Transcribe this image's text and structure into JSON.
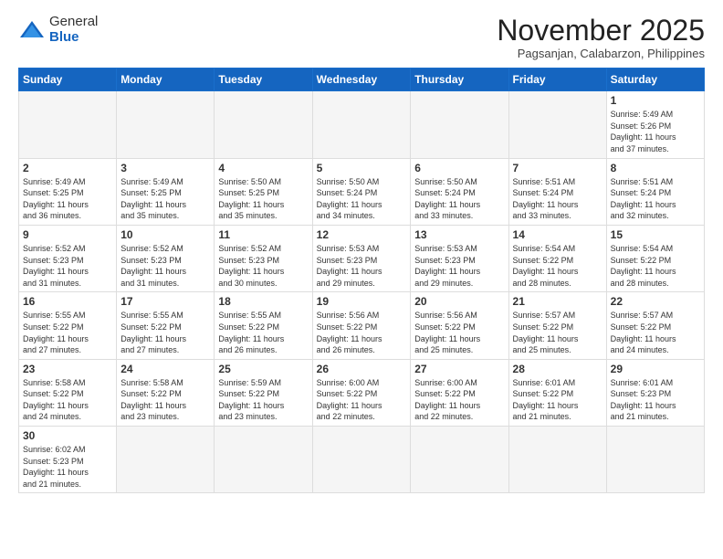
{
  "logo": {
    "general": "General",
    "blue": "Blue"
  },
  "title": "November 2025",
  "subtitle": "Pagsanjan, Calabarzon, Philippines",
  "days_of_week": [
    "Sunday",
    "Monday",
    "Tuesday",
    "Wednesday",
    "Thursday",
    "Friday",
    "Saturday"
  ],
  "weeks": [
    [
      {
        "day": "",
        "info": ""
      },
      {
        "day": "",
        "info": ""
      },
      {
        "day": "",
        "info": ""
      },
      {
        "day": "",
        "info": ""
      },
      {
        "day": "",
        "info": ""
      },
      {
        "day": "",
        "info": ""
      },
      {
        "day": "1",
        "info": "Sunrise: 5:49 AM\nSunset: 5:26 PM\nDaylight: 11 hours\nand 37 minutes."
      }
    ],
    [
      {
        "day": "2",
        "info": "Sunrise: 5:49 AM\nSunset: 5:25 PM\nDaylight: 11 hours\nand 36 minutes."
      },
      {
        "day": "3",
        "info": "Sunrise: 5:49 AM\nSunset: 5:25 PM\nDaylight: 11 hours\nand 35 minutes."
      },
      {
        "day": "4",
        "info": "Sunrise: 5:50 AM\nSunset: 5:25 PM\nDaylight: 11 hours\nand 35 minutes."
      },
      {
        "day": "5",
        "info": "Sunrise: 5:50 AM\nSunset: 5:24 PM\nDaylight: 11 hours\nand 34 minutes."
      },
      {
        "day": "6",
        "info": "Sunrise: 5:50 AM\nSunset: 5:24 PM\nDaylight: 11 hours\nand 33 minutes."
      },
      {
        "day": "7",
        "info": "Sunrise: 5:51 AM\nSunset: 5:24 PM\nDaylight: 11 hours\nand 33 minutes."
      },
      {
        "day": "8",
        "info": "Sunrise: 5:51 AM\nSunset: 5:24 PM\nDaylight: 11 hours\nand 32 minutes."
      }
    ],
    [
      {
        "day": "9",
        "info": "Sunrise: 5:52 AM\nSunset: 5:23 PM\nDaylight: 11 hours\nand 31 minutes."
      },
      {
        "day": "10",
        "info": "Sunrise: 5:52 AM\nSunset: 5:23 PM\nDaylight: 11 hours\nand 31 minutes."
      },
      {
        "day": "11",
        "info": "Sunrise: 5:52 AM\nSunset: 5:23 PM\nDaylight: 11 hours\nand 30 minutes."
      },
      {
        "day": "12",
        "info": "Sunrise: 5:53 AM\nSunset: 5:23 PM\nDaylight: 11 hours\nand 29 minutes."
      },
      {
        "day": "13",
        "info": "Sunrise: 5:53 AM\nSunset: 5:23 PM\nDaylight: 11 hours\nand 29 minutes."
      },
      {
        "day": "14",
        "info": "Sunrise: 5:54 AM\nSunset: 5:22 PM\nDaylight: 11 hours\nand 28 minutes."
      },
      {
        "day": "15",
        "info": "Sunrise: 5:54 AM\nSunset: 5:22 PM\nDaylight: 11 hours\nand 28 minutes."
      }
    ],
    [
      {
        "day": "16",
        "info": "Sunrise: 5:55 AM\nSunset: 5:22 PM\nDaylight: 11 hours\nand 27 minutes."
      },
      {
        "day": "17",
        "info": "Sunrise: 5:55 AM\nSunset: 5:22 PM\nDaylight: 11 hours\nand 27 minutes."
      },
      {
        "day": "18",
        "info": "Sunrise: 5:55 AM\nSunset: 5:22 PM\nDaylight: 11 hours\nand 26 minutes."
      },
      {
        "day": "19",
        "info": "Sunrise: 5:56 AM\nSunset: 5:22 PM\nDaylight: 11 hours\nand 26 minutes."
      },
      {
        "day": "20",
        "info": "Sunrise: 5:56 AM\nSunset: 5:22 PM\nDaylight: 11 hours\nand 25 minutes."
      },
      {
        "day": "21",
        "info": "Sunrise: 5:57 AM\nSunset: 5:22 PM\nDaylight: 11 hours\nand 25 minutes."
      },
      {
        "day": "22",
        "info": "Sunrise: 5:57 AM\nSunset: 5:22 PM\nDaylight: 11 hours\nand 24 minutes."
      }
    ],
    [
      {
        "day": "23",
        "info": "Sunrise: 5:58 AM\nSunset: 5:22 PM\nDaylight: 11 hours\nand 24 minutes."
      },
      {
        "day": "24",
        "info": "Sunrise: 5:58 AM\nSunset: 5:22 PM\nDaylight: 11 hours\nand 23 minutes."
      },
      {
        "day": "25",
        "info": "Sunrise: 5:59 AM\nSunset: 5:22 PM\nDaylight: 11 hours\nand 23 minutes."
      },
      {
        "day": "26",
        "info": "Sunrise: 6:00 AM\nSunset: 5:22 PM\nDaylight: 11 hours\nand 22 minutes."
      },
      {
        "day": "27",
        "info": "Sunrise: 6:00 AM\nSunset: 5:22 PM\nDaylight: 11 hours\nand 22 minutes."
      },
      {
        "day": "28",
        "info": "Sunrise: 6:01 AM\nSunset: 5:22 PM\nDaylight: 11 hours\nand 21 minutes."
      },
      {
        "day": "29",
        "info": "Sunrise: 6:01 AM\nSunset: 5:23 PM\nDaylight: 11 hours\nand 21 minutes."
      }
    ],
    [
      {
        "day": "30",
        "info": "Sunrise: 6:02 AM\nSunset: 5:23 PM\nDaylight: 11 hours\nand 21 minutes."
      },
      {
        "day": "",
        "info": ""
      },
      {
        "day": "",
        "info": ""
      },
      {
        "day": "",
        "info": ""
      },
      {
        "day": "",
        "info": ""
      },
      {
        "day": "",
        "info": ""
      },
      {
        "day": "",
        "info": ""
      }
    ]
  ]
}
